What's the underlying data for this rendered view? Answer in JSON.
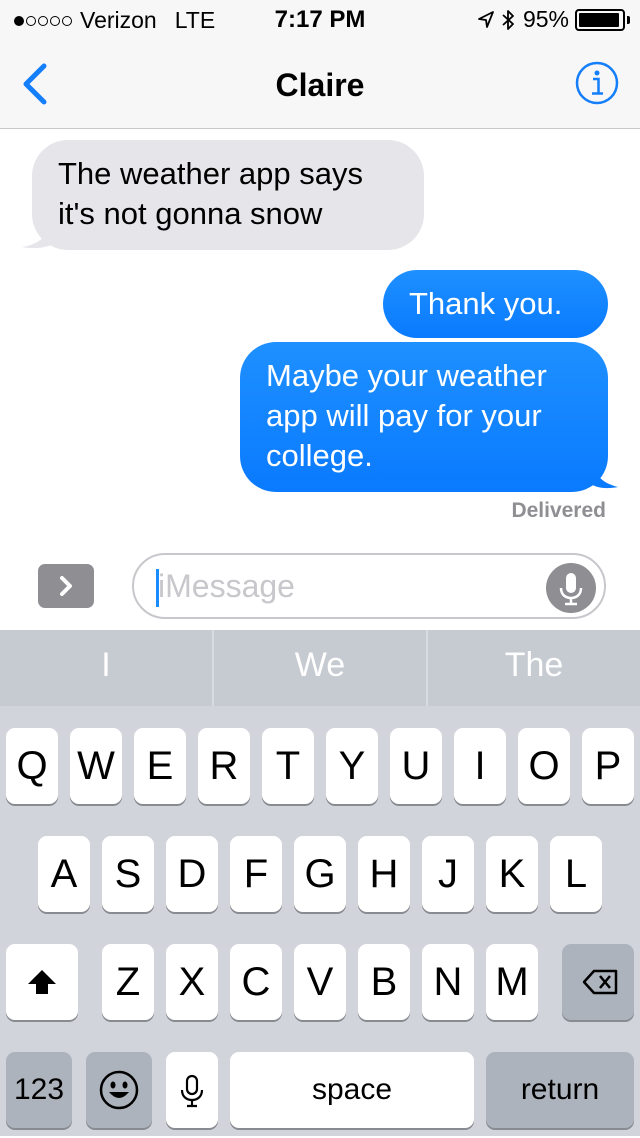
{
  "status_bar": {
    "signal_bars_filled": 1,
    "signal_bars_total": 5,
    "carrier": "Verizon",
    "network": "LTE",
    "time": "7:17 PM",
    "battery_percent": "95%",
    "battery_level": 0.95
  },
  "nav": {
    "back_icon": "chevron-left-icon",
    "title": "Claire",
    "info_icon": "info-icon",
    "accent": "#147efb"
  },
  "messages": [
    {
      "direction": "incoming",
      "text": "The weather app says it's not gonna snow"
    },
    {
      "direction": "outgoing",
      "text": "Thank you."
    },
    {
      "direction": "outgoing",
      "text": "Maybe your weather app will pay for your college."
    }
  ],
  "delivered_label": "Delivered",
  "compose": {
    "placeholder": "iMessage",
    "value": ""
  },
  "predictive": [
    "I",
    "We",
    "The"
  ],
  "keyboard": {
    "row1": [
      "Q",
      "W",
      "E",
      "R",
      "T",
      "Y",
      "U",
      "I",
      "O",
      "P"
    ],
    "row2": [
      "A",
      "S",
      "D",
      "F",
      "G",
      "H",
      "J",
      "K",
      "L"
    ],
    "row3": [
      "Z",
      "X",
      "C",
      "V",
      "B",
      "N",
      "M"
    ],
    "numbers_label": "123",
    "space_label": "space",
    "return_label": "return"
  },
  "colors": {
    "incoming_bubble": "#e5e5ea",
    "outgoing_bubble": "#1a8cff",
    "keyboard_bg": "#d1d5db"
  }
}
